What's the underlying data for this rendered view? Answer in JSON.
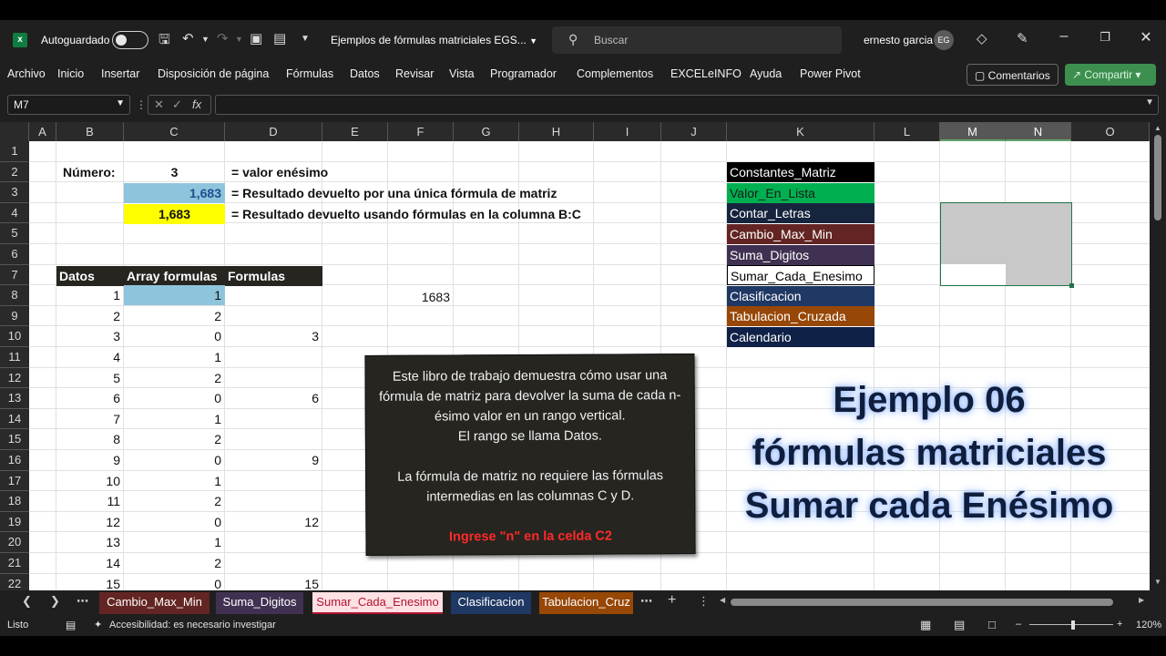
{
  "titlebar": {
    "autosave_label": "Autoguardado",
    "doc_title": "Ejemplos de fórmulas matriciales EGS...",
    "search_placeholder": "Buscar",
    "user_name": "ernesto garcia",
    "user_initials": "EG"
  },
  "ribbon": {
    "tabs": [
      "Archivo",
      "Inicio",
      "Insertar",
      "Disposición de página",
      "Fórmulas",
      "Datos",
      "Revisar",
      "Vista",
      "Programador",
      "Complementos",
      "EXCELeINFO",
      "Ayuda",
      "Power Pivot"
    ],
    "comments": "Comentarios",
    "share": "Compartir"
  },
  "formula_bar": {
    "name_box": "M7",
    "fx": "fx",
    "formula": ""
  },
  "columns": [
    "A",
    "B",
    "C",
    "D",
    "E",
    "F",
    "G",
    "H",
    "I",
    "J",
    "K",
    "L",
    "M",
    "N",
    "O"
  ],
  "rows": [
    "1",
    "2",
    "3",
    "4",
    "5",
    "6",
    "7",
    "8",
    "9",
    "10",
    "11",
    "12",
    "13",
    "14",
    "15",
    "16",
    "17",
    "18",
    "19",
    "20",
    "21",
    "22"
  ],
  "cells": {
    "b2": "Número:",
    "c2": "3",
    "d2": "= valor enésimo",
    "c3": "1,683",
    "d3": "= Resultado devuelto por una única fórmula de matriz",
    "c4": "1,683",
    "d4": "= Resultado devuelto usando fórmulas en la columna B:C",
    "b7": "Datos",
    "c7": "Array formulas",
    "d7": "Formulas",
    "f8": "1683"
  },
  "table": {
    "datos": [
      "1",
      "2",
      "3",
      "4",
      "5",
      "6",
      "7",
      "8",
      "9",
      "10",
      "11",
      "12",
      "13",
      "14",
      "15"
    ],
    "array": [
      "1",
      "2",
      "0",
      "1",
      "2",
      "0",
      "1",
      "2",
      "0",
      "1",
      "2",
      "0",
      "1",
      "2",
      "0"
    ],
    "formulas": [
      "",
      "",
      "3",
      "",
      "",
      "6",
      "",
      "",
      "9",
      "",
      "",
      "12",
      "",
      "",
      "15"
    ]
  },
  "nav_list": [
    {
      "label": "Constantes_Matriz",
      "bg": "#000000",
      "fg": "#ffffff"
    },
    {
      "label": "Valor_En_Lista",
      "bg": "#00b050",
      "fg": "#1a1a1a"
    },
    {
      "label": "Contar_Letras",
      "bg": "#16243e",
      "fg": "#ffffff"
    },
    {
      "label": "Cambio_Max_Min",
      "bg": "#632523",
      "fg": "#ffffff"
    },
    {
      "label": "Suma_Digitos",
      "bg": "#403152",
      "fg": "#ffffff"
    },
    {
      "label": "Sumar_Cada_Enesimo",
      "bg": "#ffffff",
      "fg": "#000000"
    },
    {
      "label": "Clasificacion",
      "bg": "#1f3864",
      "fg": "#ffffff"
    },
    {
      "label": "Tabulacion_Cruzada",
      "bg": "#974706",
      "fg": "#ffffff"
    },
    {
      "label": "Calendario",
      "bg": "#0f2147",
      "fg": "#ffffff"
    }
  ],
  "note": {
    "p1": "Este libro de trabajo demuestra cómo usar una fórmula de matriz para devolver la suma de cada n-ésimo valor en un rango vertical.",
    "p2": "El rango se llama Datos.",
    "p3": "La fórmula de matriz no requiere las fórmulas intermedias en las columnas C y D.",
    "p4": "Ingrese \"n\" en la celda C2"
  },
  "overlay": {
    "line1": "Ejemplo 06",
    "line2": "fórmulas matriciales",
    "line3": "Sumar cada Enésimo"
  },
  "sheet_tabs": [
    {
      "label": "Cambio_Max_Min",
      "color": "#632523"
    },
    {
      "label": "Suma_Digitos",
      "color": "#403152"
    },
    {
      "label": "Sumar_Cada_Enesimo",
      "color": "#ffffff"
    },
    {
      "label": "Clasificacion",
      "color": "#1f3864"
    },
    {
      "label": "Tabulacion_Cruz",
      "color": "#974706"
    }
  ],
  "status": {
    "ready": "Listo",
    "accessibility": "Accesibilidad: es necesario investigar",
    "zoom": "120%"
  },
  "colors": {
    "accent_green": "#107c41",
    "cell_c3_bg": "#8fc5dc",
    "cell_c4_bg": "#ffff00",
    "header_dark": "#262520"
  }
}
